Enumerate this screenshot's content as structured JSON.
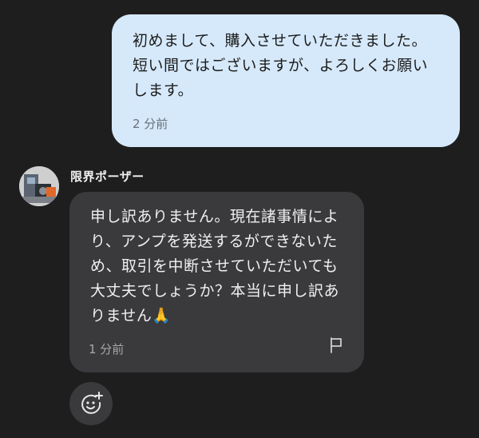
{
  "outgoing_message": {
    "text": "初めまして、購入させていただきました。短い間ではございますが、よろしくお願いします。",
    "time": "2 分前"
  },
  "incoming_message": {
    "sender": "限界ポーザー",
    "text": "申し訳ありません。現在諸事情により、アンプを発送するができないため、取引を中断させていただいても大丈夫でしょうか？本当に申し訳ありません🙏",
    "time": "1 分前"
  },
  "icons": {
    "avatar": "user-avatar",
    "flag": "flag-icon",
    "reaction": "add-reaction-icon"
  },
  "colors": {
    "background": "#1f1e1f",
    "outgoing_bubble": "#d6e9fb",
    "incoming_bubble": "#3a393c"
  }
}
